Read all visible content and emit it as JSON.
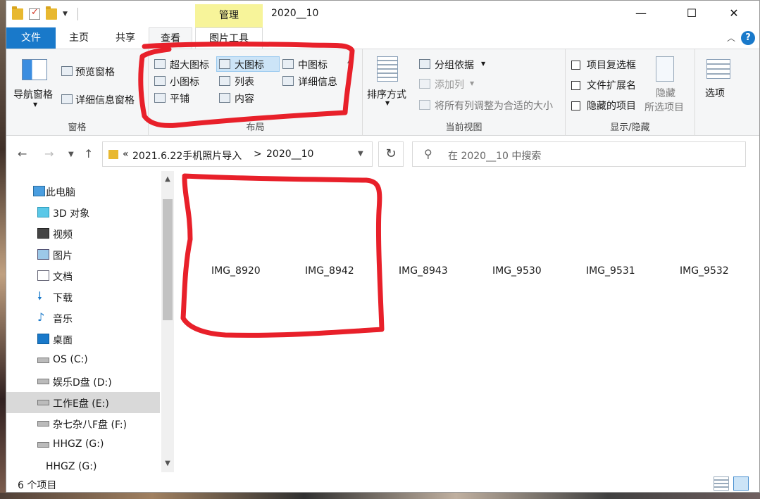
{
  "title_bar": {
    "context_tab": "管理",
    "window_title": "2020__10",
    "minimize": "—",
    "maximize": "☐",
    "close": "✕"
  },
  "tabs": [
    {
      "label": "文件"
    },
    {
      "label": "主页"
    },
    {
      "label": "共享"
    },
    {
      "label": "查看"
    },
    {
      "label": "图片工具"
    }
  ],
  "ribbon": {
    "panes": {
      "nav_pane": "导航窗格",
      "preview_pane": "预览窗格",
      "details_pane": "详细信息窗格",
      "label": "窗格"
    },
    "layout": {
      "items": [
        "超大图标",
        "大图标",
        "中图标",
        "小图标",
        "列表",
        "详细信息",
        "平铺",
        "内容"
      ],
      "selected": "大图标",
      "label": "布局"
    },
    "current_view": {
      "sort": "排序方式",
      "group_by": "分组依据",
      "add_columns": "添加列",
      "fit_columns": "将所有列调整为合适的大小",
      "label": "当前视图"
    },
    "show_hide": {
      "item_checkboxes": "项目复选框",
      "file_extensions": "文件扩展名",
      "hidden_items": "隐藏的项目",
      "hide_selected_1": "隐藏",
      "hide_selected_2": "所选项目",
      "label": "显示/隐藏"
    },
    "options": "选项"
  },
  "address": {
    "prefix": "«",
    "crumb_parent": "2021.6.22手机照片导入",
    "sep": ">",
    "crumb_current": "2020__10",
    "search_placeholder": "在 2020__10 中搜索"
  },
  "nav_pane": {
    "items": [
      {
        "label": "此电脑",
        "icon": "computer-icon"
      },
      {
        "label": "3D 对象",
        "icon": "3d-objects-icon"
      },
      {
        "label": "视频",
        "icon": "video-icon"
      },
      {
        "label": "图片",
        "icon": "pictures-icon"
      },
      {
        "label": "文档",
        "icon": "documents-icon"
      },
      {
        "label": "下载",
        "icon": "download-icon"
      },
      {
        "label": "音乐",
        "icon": "music-icon"
      },
      {
        "label": "桌面",
        "icon": "desktop-icon"
      },
      {
        "label": "OS (C:)",
        "icon": "drive-icon"
      },
      {
        "label": "娱乐D盘 (D:)",
        "icon": "drive-icon"
      },
      {
        "label": "工作E盘 (E:)",
        "icon": "drive-icon"
      },
      {
        "label": "杂七杂八F盘 (F:)",
        "icon": "drive-icon"
      },
      {
        "label": "HHGZ (G:)",
        "icon": "drive-icon"
      },
      {
        "label": "HHGZ (G:)",
        "icon": "drive-icon"
      }
    ],
    "selected": "工作E盘 (E:)"
  },
  "files": [
    "IMG_8920",
    "IMG_8942",
    "IMG_8943",
    "IMG_9530",
    "IMG_9531",
    "IMG_9532"
  ],
  "status": {
    "count": "6 个项目"
  },
  "colors": {
    "accent": "#1979ca",
    "context_tab": "#f7f49a",
    "annotation": "#e8202a"
  }
}
